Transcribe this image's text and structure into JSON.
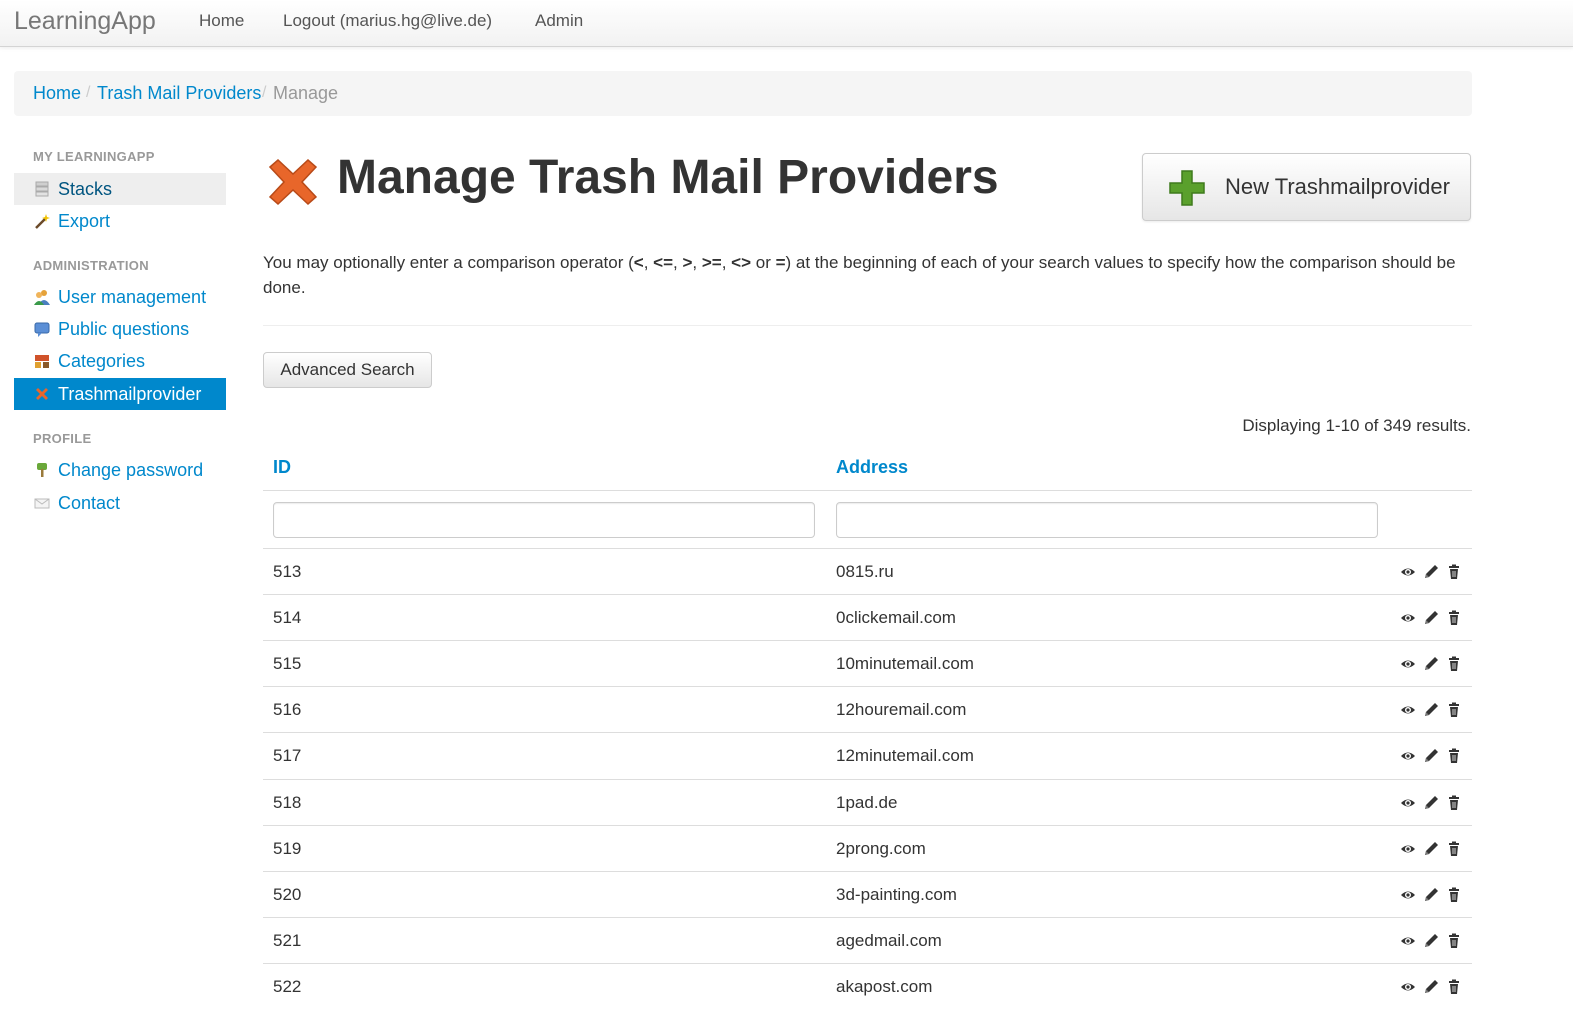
{
  "navbar": {
    "brand": "LearningApp",
    "links": [
      "Home",
      "Logout (marius.hg@live.de)",
      "Admin"
    ]
  },
  "breadcrumb": {
    "items": [
      "Home",
      "Trash Mail Providers",
      "Manage"
    ],
    "separator": "/"
  },
  "sidebar": {
    "sections": [
      {
        "header": "MY LEARNINGAPP",
        "items": [
          {
            "label": "Stacks",
            "icon": "stacks-icon"
          },
          {
            "label": "Export",
            "icon": "wand-icon"
          }
        ]
      },
      {
        "header": "ADMINISTRATION",
        "items": [
          {
            "label": "User management",
            "icon": "users-icon"
          },
          {
            "label": "Public questions",
            "icon": "speech-bubble-icon"
          },
          {
            "label": "Categories",
            "icon": "categories-icon"
          },
          {
            "label": "Trashmailprovider",
            "icon": "cross-icon"
          }
        ]
      },
      {
        "header": "PROFILE",
        "items": [
          {
            "label": "Change password",
            "icon": "key-icon"
          },
          {
            "label": "Contact",
            "icon": "envelope-icon"
          }
        ]
      }
    ],
    "active_item": "Trashmailprovider"
  },
  "page": {
    "title": "Manage Trash Mail Providers",
    "title_icon": "cross-icon",
    "new_button": "New Trashmailprovider",
    "help_prefix": "You may optionally enter a comparison operator (",
    "help_ops": [
      "<",
      "<=",
      ">",
      ">=",
      "<>",
      "="
    ],
    "help_seps": [
      ", ",
      ", ",
      ", ",
      ", ",
      " or "
    ],
    "help_suffix": ") at the beginning of each of your search values to specify how the comparison should be done.",
    "advanced_search": "Advanced Search",
    "summary": "Displaying 1-10 of 349 results."
  },
  "grid": {
    "columns": [
      "ID",
      "Address"
    ],
    "filters": [
      "",
      ""
    ],
    "rows": [
      {
        "id": "513",
        "address": "0815.ru"
      },
      {
        "id": "514",
        "address": "0clickemail.com"
      },
      {
        "id": "515",
        "address": "10minutemail.com"
      },
      {
        "id": "516",
        "address": "12houremail.com"
      },
      {
        "id": "517",
        "address": "12minutemail.com"
      },
      {
        "id": "518",
        "address": "1pad.de"
      },
      {
        "id": "519",
        "address": "2prong.com"
      },
      {
        "id": "520",
        "address": "3d-painting.com"
      },
      {
        "id": "521",
        "address": "agedmail.com"
      },
      {
        "id": "522",
        "address": "akapost.com"
      }
    ],
    "row_actions": [
      "eye-icon",
      "pencil-icon",
      "trash-icon"
    ]
  },
  "colors": {
    "link": "#0088cc",
    "active_bg": "#0088cc",
    "cross_icon": "#e8662a",
    "plus_icon": "#5aa02c"
  }
}
